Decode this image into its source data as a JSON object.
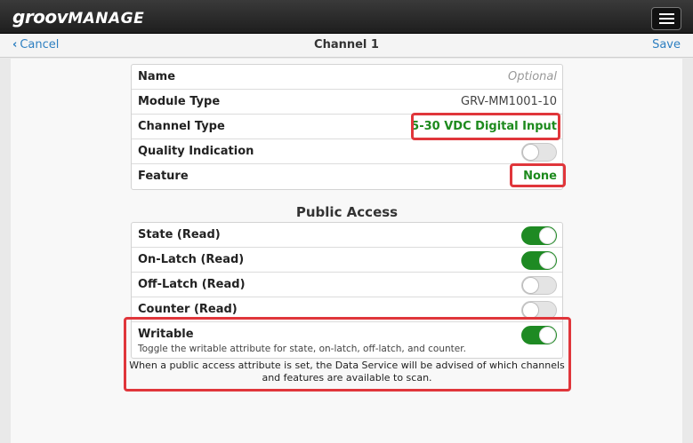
{
  "app": {
    "logo_main": "groov",
    "logo_sub": "MANAGE"
  },
  "nav": {
    "cancel_label": "Cancel",
    "title": "Channel 1",
    "save_label": "Save"
  },
  "channel_settings": {
    "name_label": "Name",
    "name_placeholder": "Optional",
    "module_type_label": "Module Type",
    "module_type_value": "GRV-MM1001-10",
    "channel_type_label": "Channel Type",
    "channel_type_value": "5-30 VDC Digital Input",
    "quality_label": "Quality Indication",
    "quality_enabled": false,
    "feature_label": "Feature",
    "feature_value": "None"
  },
  "public_access": {
    "title": "Public Access",
    "items": [
      {
        "label": "State (Read)",
        "enabled": true
      },
      {
        "label": "On-Latch (Read)",
        "enabled": true
      },
      {
        "label": "Off-Latch (Read)",
        "enabled": false
      },
      {
        "label": "Counter (Read)",
        "enabled": false
      }
    ],
    "writable_label": "Writable",
    "writable_description": "Toggle the writable attribute for state, on-latch, off-latch, and counter.",
    "writable_enabled": true,
    "note": "When a public access attribute is set, the Data Service will be advised of which channels and features are available to scan."
  },
  "colors": {
    "accent": "#2d7fc1",
    "toggle_on": "#1e8a23",
    "value_green": "#1d8a1d",
    "highlight": "#e0363b"
  }
}
